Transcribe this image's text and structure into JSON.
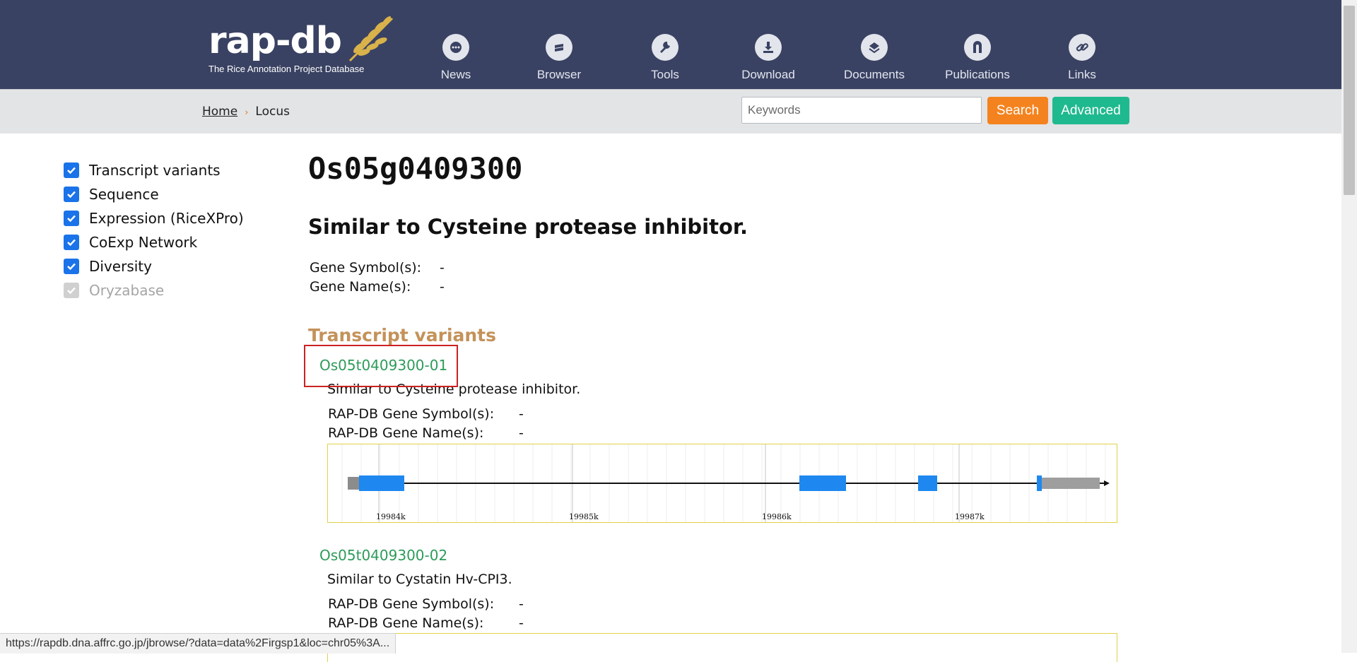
{
  "header": {
    "logo_text": "rap-db",
    "logo_subtitle": "The Rice Annotation Project Database",
    "nav": [
      {
        "label": "News",
        "icon": "chat-icon"
      },
      {
        "label": "Browser",
        "icon": "browser-icon"
      },
      {
        "label": "Tools",
        "icon": "wrench-icon"
      },
      {
        "label": "Download",
        "icon": "download-icon"
      },
      {
        "label": "Documents",
        "icon": "documents-icon"
      },
      {
        "label": "Publications",
        "icon": "publications-icon"
      },
      {
        "label": "Links",
        "icon": "link-icon"
      }
    ]
  },
  "subbar": {
    "breadcrumb_home": "Home",
    "breadcrumb_separator": "›",
    "breadcrumb_current": "Locus",
    "search_placeholder": "Keywords",
    "search_button": "Search",
    "advanced_button": "Advanced"
  },
  "sidebar": {
    "items": [
      {
        "label": "Transcript variants",
        "checked": true,
        "disabled": false
      },
      {
        "label": "Sequence",
        "checked": true,
        "disabled": false
      },
      {
        "label": "Expression (RiceXPro)",
        "checked": true,
        "disabled": false
      },
      {
        "label": "CoExp Network",
        "checked": true,
        "disabled": false
      },
      {
        "label": "Diversity",
        "checked": true,
        "disabled": false
      },
      {
        "label": "Oryzabase",
        "checked": true,
        "disabled": true
      }
    ]
  },
  "main": {
    "locus_id": "Os05g0409300",
    "description": "Similar to Cysteine protease inhibitor.",
    "gene_symbol_label": "Gene Symbol(s):",
    "gene_symbol_value": "-",
    "gene_name_label": "Gene Name(s):",
    "gene_name_value": "-",
    "section_title": "Transcript variants",
    "transcripts": [
      {
        "id": "Os05t0409300-01",
        "description": "Similar to Cysteine protease inhibitor.",
        "symbol_label": "RAP-DB Gene Symbol(s):",
        "symbol_value": "-",
        "name_label": "RAP-DB Gene Name(s):",
        "name_value": "-",
        "track_ticks": [
          "19984k",
          "19985k",
          "19986k",
          "19987k"
        ]
      },
      {
        "id": "Os05t0409300-02",
        "description": "Similar to Cystatin Hv-CPI3.",
        "symbol_label": "RAP-DB Gene Symbol(s):",
        "symbol_value": "-",
        "name_label": "RAP-DB Gene Name(s):",
        "name_value": "-"
      }
    ]
  },
  "status_url": "https://rapdb.dna.affrc.go.jp/jbrowse/?data=data%2Firgsp1&loc=chr05%3A...",
  "colors": {
    "header_bg": "#3a4263",
    "exon_blue": "#1e88f0",
    "utr_gray": "#999999",
    "link_green": "#2e9b5a",
    "section_tan": "#c4925a",
    "search_orange": "#f4831f",
    "advanced_green": "#1fb98f"
  }
}
